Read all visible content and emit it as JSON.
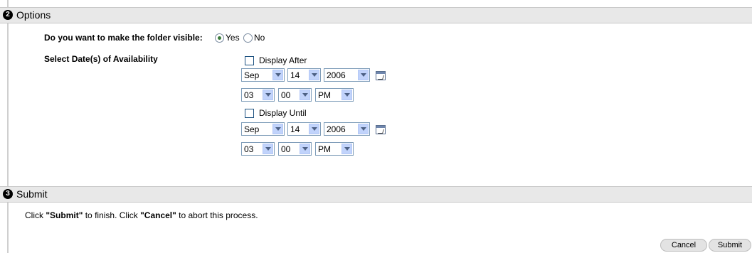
{
  "options": {
    "step_number": "2",
    "title": "Options",
    "visible_label": "Do you want to make the folder visible:",
    "visible_yes": "Yes",
    "visible_no": "No",
    "visible_selected": "Yes",
    "dates_label": "Select Date(s) of Availability",
    "display_after": {
      "label": "Display After",
      "checked": false,
      "month": "Sep",
      "day": "14",
      "year": "2006",
      "hour": "03",
      "minute": "00",
      "ampm": "PM"
    },
    "display_until": {
      "label": "Display Until",
      "checked": false,
      "month": "Sep",
      "day": "14",
      "year": "2006",
      "hour": "03",
      "minute": "00",
      "ampm": "PM"
    }
  },
  "submit": {
    "step_number": "3",
    "title": "Submit",
    "instruction_prefix": "Click ",
    "instruction_submit": "\"Submit\"",
    "instruction_middle": " to finish. Click ",
    "instruction_cancel": "\"Cancel\"",
    "instruction_suffix": " to abort this process.",
    "cancel_label": "Cancel",
    "submit_label": "Submit"
  },
  "icons": [
    "calendar-icon",
    "radio-selected-icon",
    "radio-unselected-icon",
    "chevron-down-icon"
  ]
}
